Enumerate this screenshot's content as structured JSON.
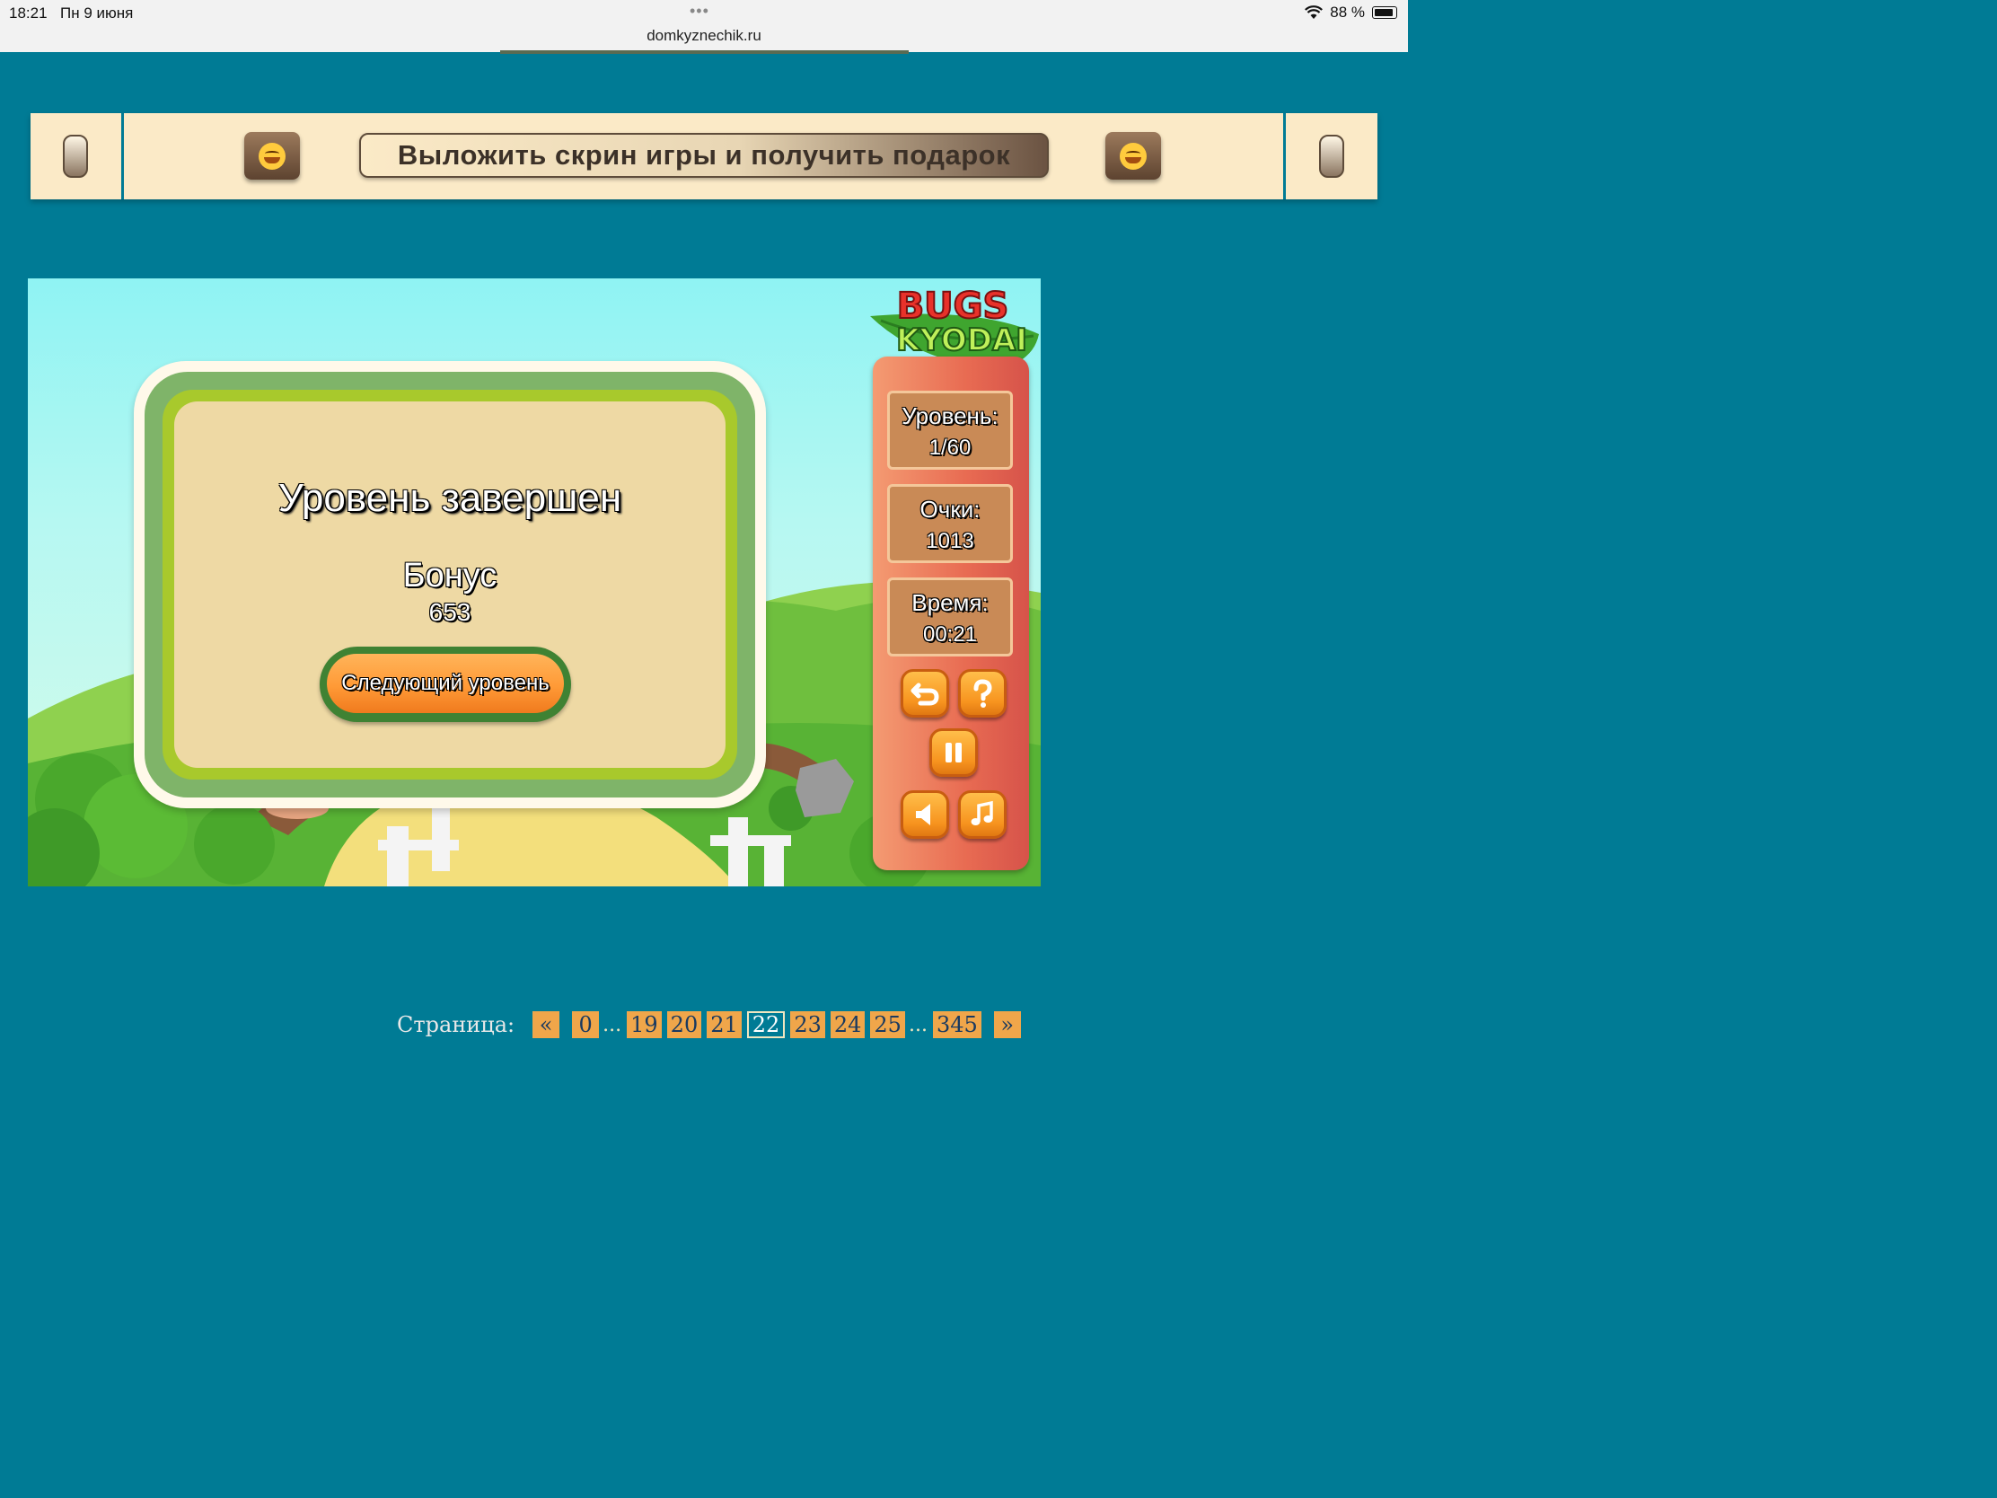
{
  "status_bar": {
    "time": "18:21",
    "date": "Пн 9 июня",
    "url": "domkyznechik.ru",
    "battery": "88 %",
    "dots": "•••"
  },
  "banner": {
    "cta_label": "Выложить скрин игры и получить подарок"
  },
  "game": {
    "logo_top": "BUGS",
    "logo_bottom": "KYODAI",
    "dialog": {
      "title": "Уровень завершен",
      "bonus_label": "Бонус",
      "bonus_value": "653",
      "next_button": "Следующий уровень"
    },
    "stats": {
      "level_label": "Уровень:",
      "level_value": "1/60",
      "score_label": "Очки:",
      "score_value": "1013",
      "time_label": "Время:",
      "time_value": "00:21"
    },
    "controls": [
      "undo-icon",
      "question-icon",
      "pause-icon",
      "sound-icon",
      "music-icon"
    ]
  },
  "pagination": {
    "label": "Страница:",
    "prev": "«",
    "next": "»",
    "ellipsis": "...",
    "pages": [
      "0",
      "19",
      "20",
      "21",
      "22",
      "23",
      "24",
      "25",
      "345"
    ],
    "current": "22"
  },
  "colors": {
    "page_bg": "#007b95",
    "banner_bg": "#fbeac7",
    "pager_button": "#f0a64a"
  }
}
